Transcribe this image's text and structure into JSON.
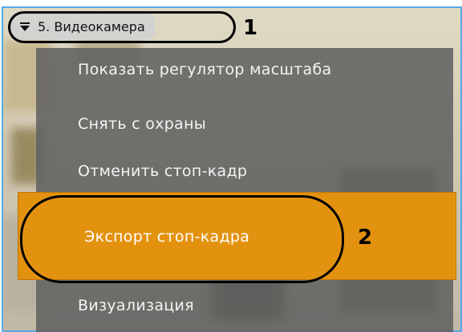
{
  "doc_header": "5. Видеокамера",
  "camera": {
    "title": "5. Видеокамера",
    "menu_icon": "chevron-down-icon"
  },
  "callouts": [
    "1",
    "2"
  ],
  "menu": {
    "items": [
      "Показать регулятор масштаба",
      "Снять с охраны",
      "Отменить стоп-кадр",
      "Экспорт стоп-кадра",
      "Визуализация"
    ],
    "highlighted_index": 3
  },
  "colors": {
    "highlight": "#e3920f",
    "menu_bg": "#5f5f5f",
    "frame_border": "#5aa9e6"
  }
}
